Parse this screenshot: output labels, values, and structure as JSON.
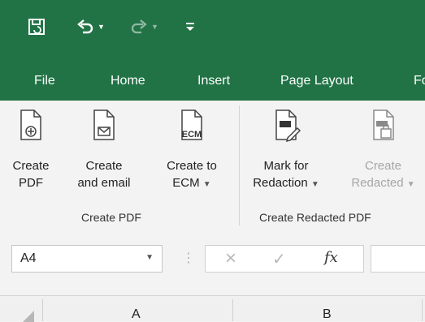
{
  "quick_access": {
    "save_icon": "save-icon",
    "undo_icon": "undo-icon",
    "redo_icon": "redo-icon",
    "customize_icon": "customize-qat-icon"
  },
  "tabs": [
    {
      "label": "File"
    },
    {
      "label": "Home"
    },
    {
      "label": "Insert"
    },
    {
      "label": "Page Layout"
    },
    {
      "label": "Fo"
    }
  ],
  "ribbon": {
    "create_pdf_group": {
      "label": "Create PDF",
      "buttons": [
        {
          "line1": "Create",
          "line2": "PDF",
          "icon": "create-pdf-icon"
        },
        {
          "line1": "Create",
          "line2": "and email",
          "icon": "create-email-icon"
        },
        {
          "line1": "Create to",
          "line2": "ECM",
          "icon": "create-ecm-icon",
          "icon_text": "ECM"
        }
      ]
    },
    "redacted_group": {
      "label": "Create Redacted PDF",
      "buttons": [
        {
          "line1": "Mark for",
          "line2": "Redaction",
          "icon": "mark-redaction-icon"
        },
        {
          "line1": "Create",
          "line2": "Redacted",
          "icon": "create-redacted-icon"
        }
      ]
    }
  },
  "formula_bar": {
    "name_box_value": "A4",
    "fx_label": "fx"
  },
  "columns": [
    {
      "label": "A"
    },
    {
      "label": "B"
    }
  ],
  "colors": {
    "accent": "#217346",
    "ribbon_bg": "#f3f3f3",
    "disabled_text": "#a6a6a6"
  }
}
